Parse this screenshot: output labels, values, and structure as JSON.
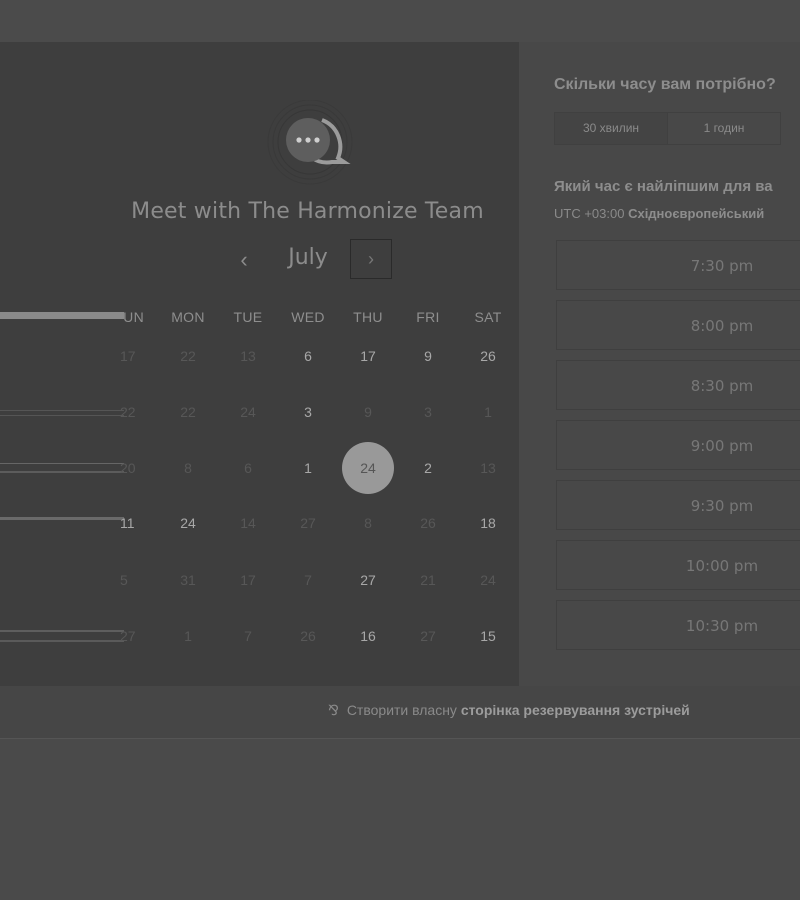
{
  "brand": {
    "title": "Meet with The Harmonize Team",
    "logo_icon": "chat-bubble-dots-icon"
  },
  "calendar": {
    "month": "July",
    "prev_symbol": "‹",
    "next_symbol": "›",
    "weekdays": [
      "UN",
      "MON",
      "TUE",
      "WED",
      "THU",
      "FRI",
      "SAT"
    ],
    "rows": [
      [
        {
          "d": "17",
          "on": false
        },
        {
          "d": "22",
          "on": false
        },
        {
          "d": "13",
          "on": false
        },
        {
          "d": "6",
          "on": true
        },
        {
          "d": "17",
          "on": true
        },
        {
          "d": "9",
          "on": true
        },
        {
          "d": "26",
          "on": true
        }
      ],
      [
        {
          "d": "22",
          "on": false
        },
        {
          "d": "22",
          "on": false
        },
        {
          "d": "24",
          "on": false
        },
        {
          "d": "3",
          "on": true
        },
        {
          "d": "9",
          "on": false
        },
        {
          "d": "3",
          "on": false
        },
        {
          "d": "1",
          "on": false
        }
      ],
      [
        {
          "d": "20",
          "on": false
        },
        {
          "d": "8",
          "on": false
        },
        {
          "d": "6",
          "on": false
        },
        {
          "d": "1",
          "on": true
        },
        {
          "d": "24",
          "on": true,
          "sel": true
        },
        {
          "d": "2",
          "on": true
        },
        {
          "d": "13",
          "on": false
        }
      ],
      [
        {
          "d": "11",
          "on": true
        },
        {
          "d": "24",
          "on": true
        },
        {
          "d": "14",
          "on": false
        },
        {
          "d": "27",
          "on": false
        },
        {
          "d": "8",
          "on": false
        },
        {
          "d": "26",
          "on": false
        },
        {
          "d": "18",
          "on": true
        }
      ],
      [
        {
          "d": "5",
          "on": false
        },
        {
          "d": "31",
          "on": false
        },
        {
          "d": "17",
          "on": false
        },
        {
          "d": "7",
          "on": false
        },
        {
          "d": "27",
          "on": true
        },
        {
          "d": "21",
          "on": false
        },
        {
          "d": "24",
          "on": false
        }
      ],
      [
        {
          "d": "27",
          "on": false
        },
        {
          "d": "1",
          "on": false
        },
        {
          "d": "7",
          "on": false
        },
        {
          "d": "26",
          "on": false
        },
        {
          "d": "16",
          "on": true
        },
        {
          "d": "27",
          "on": false
        },
        {
          "d": "15",
          "on": true
        }
      ]
    ]
  },
  "booking": {
    "duration_question": "Скільки часу вам потрібно?",
    "durations": [
      "30 хвилин",
      "1 годин"
    ],
    "time_question": "Який час є найліпшим для ва",
    "timezone_offset": "UTC +03:00",
    "timezone_name": "Східноєвропейський",
    "slots": [
      "7:30 pm",
      "8:00 pm",
      "8:30 pm",
      "9:00 pm",
      "9:30 pm",
      "10:00 pm",
      "10:30 pm"
    ]
  },
  "footer": {
    "link_icon": "hubspot-sprocket-icon",
    "link_prefix": "Створити власну",
    "link_bold": "сторінка резервування зустрічей"
  }
}
